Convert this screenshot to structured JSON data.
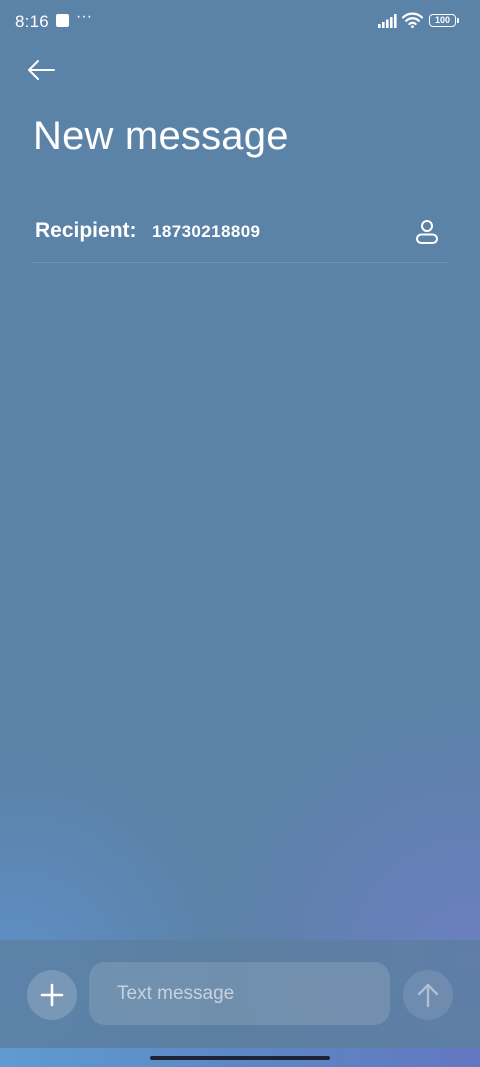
{
  "status_bar": {
    "time": "8:16",
    "more_indicator": "···",
    "battery_level": "100",
    "icons": [
      "notification-square-icon",
      "signal-icon",
      "wifi-icon",
      "battery-icon"
    ]
  },
  "header": {
    "back_icon": "arrow-left-icon",
    "title": "New message"
  },
  "recipient": {
    "label": "Recipient:",
    "value": "18730218809",
    "contact_icon": "person-icon"
  },
  "compose": {
    "attach_icon": "plus-icon",
    "placeholder": "Text message",
    "send_icon": "arrow-up-icon"
  },
  "colors": {
    "background": "#5b82a7",
    "text": "#ffffff",
    "compose_bar": "#5c7e9e"
  }
}
